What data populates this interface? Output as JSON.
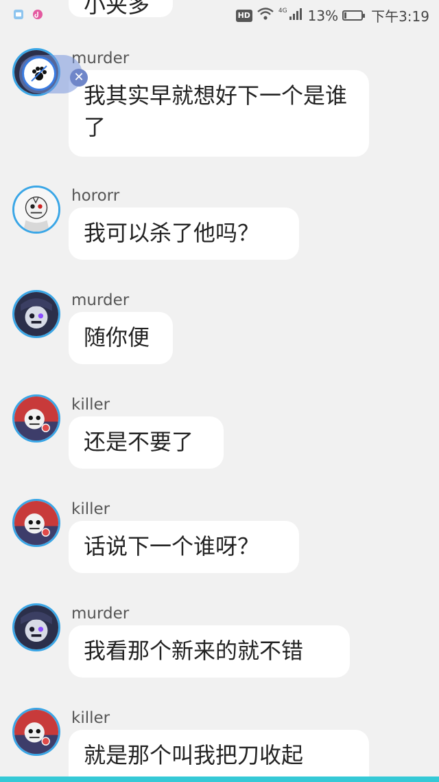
{
  "status_bar": {
    "hd": "HD",
    "network": "4G",
    "battery": "13%",
    "time": "下午3:19",
    "battery_level": 0.13
  },
  "partial_message": {
    "text": "小夹多"
  },
  "messages": [
    {
      "user": "murder",
      "text": "我其实早就想好下一个是谁了",
      "avatar": "murder-avatar"
    },
    {
      "user": "hororr",
      "text": "我可以杀了他吗？",
      "avatar": "horror-avatar"
    },
    {
      "user": "murder",
      "text": "随你便",
      "avatar": "murder-avatar"
    },
    {
      "user": "killer",
      "text": "还是不要了",
      "avatar": "killer-avatar"
    },
    {
      "user": "killer",
      "text": "话说下一个谁呀？",
      "avatar": "killer-avatar"
    },
    {
      "user": "murder",
      "text": "我看那个新来的就不错",
      "avatar": "murder-avatar"
    },
    {
      "user": "killer",
      "text": "就是那个叫我把刀收起",
      "avatar": "killer-avatar"
    }
  ],
  "overlay": {
    "paw_icon": "paw-icon",
    "close_icon": "close-icon",
    "close_glyph": "✕"
  },
  "colors": {
    "background": "#f1f1f1",
    "bubble": "#ffffff",
    "avatar_ring": "#3aa6e6",
    "bottom_strip": "#35c9d6"
  }
}
